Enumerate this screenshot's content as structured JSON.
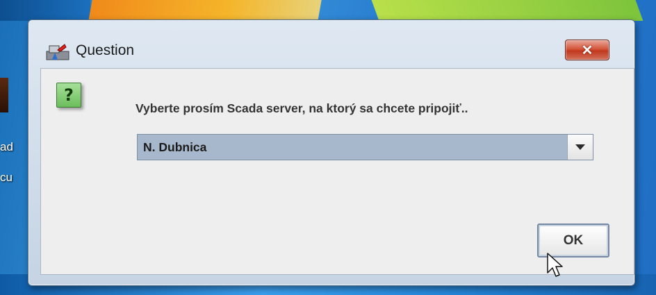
{
  "desktop": {
    "label_fragment_1": "ad",
    "label_fragment_2": "cu"
  },
  "dialog": {
    "title": "Question",
    "close_label": "✕",
    "message": "Vyberte prosím Scada server, na ktorý sa chcete pripojiť..",
    "question_glyph": "?",
    "server_select": {
      "selected_value": "N. Dubnica"
    },
    "ok_label": "OK"
  },
  "icons": {
    "title_icon": "java-app-icon",
    "question_icon": "question-icon",
    "dropdown_icon": "chevron-down-icon",
    "cursor": "mouse-pointer-icon"
  },
  "colors": {
    "close_button": "#c0381d",
    "question_icon": "#6cbe5c",
    "combo_background": "#a8b8cc",
    "dialog_frame": "#c5d3e3"
  }
}
